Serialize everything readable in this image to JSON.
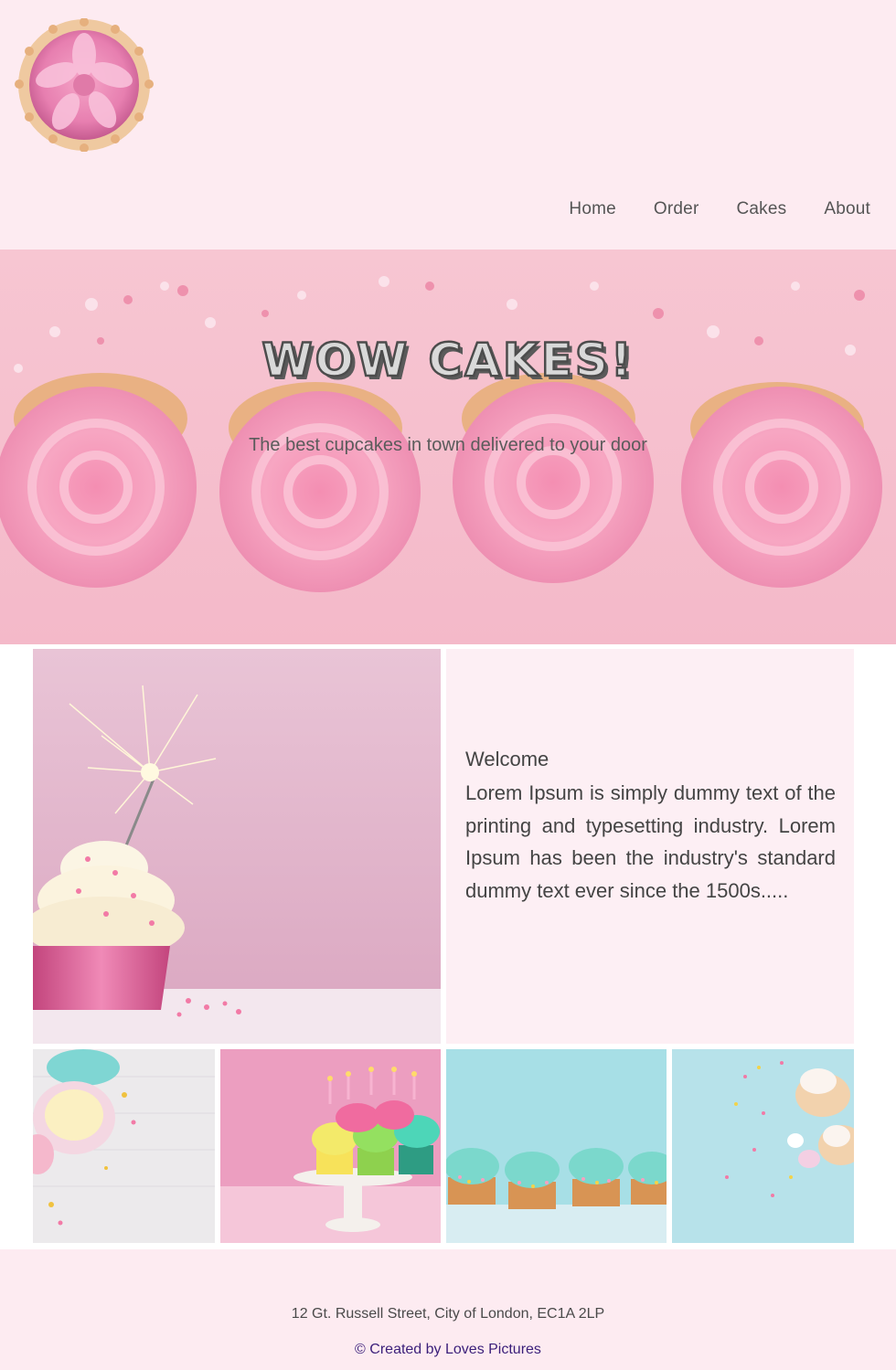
{
  "header": {
    "logo_alt": "cupcake logo",
    "nav": [
      "Home",
      "Order",
      "Cakes",
      "About"
    ]
  },
  "hero": {
    "title": "WOW CAKES!",
    "subtitle": "The best cupcakes in town delivered to your door"
  },
  "welcome": {
    "title": "Welcome",
    "text": "Lorem Ipsum is simply dummy text of the printing and typesetting industry. Lorem Ipsum has been the industry's standard dummy text ever since the 1500s....."
  },
  "gallery": [
    "cupcakes-with-sprinkles",
    "birthday-cupcakes-stand",
    "mint-cupcakes-row",
    "cupcakes-blue-background"
  ],
  "footer": {
    "address": "12 Gt. Russell Street, City of London, EC1A 2LP",
    "credit": "© Created by Loves Pictures"
  },
  "colors": {
    "header_bg": "#fdebf1",
    "hero_bg": "#f6c2cf",
    "welcome_bg": "#fdeff4",
    "credit_text": "#3b1f7a"
  }
}
